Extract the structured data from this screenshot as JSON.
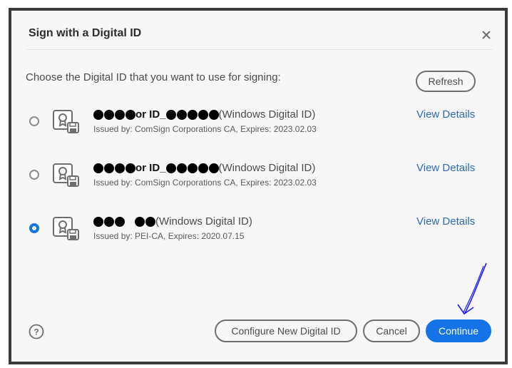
{
  "dialog": {
    "title": "Sign with a Digital ID",
    "close_icon": "close-icon"
  },
  "prompt": "Choose the Digital ID that you want to use for signing:",
  "refresh_label": "Refresh",
  "digital_ids": [
    {
      "selected": false,
      "name_visible_fragment": "or ID_",
      "type": "(Windows Digital ID)",
      "issued": "Issued by: ComSign Corporations CA, Expires: 2023.02.03",
      "view_details": "View Details",
      "icon": "certificate-icon"
    },
    {
      "selected": false,
      "name_visible_fragment": "or ID_",
      "type": "(Windows Digital ID)",
      "issued": "Issued by: ComSign Corporations CA, Expires: 2023.02.03",
      "view_details": "View Details",
      "icon": "certificate-icon"
    },
    {
      "selected": true,
      "name_visible_fragment": "",
      "type": "(Windows Digital ID)",
      "issued": "Issued by: PEI-CA, Expires: 2020.07.15",
      "view_details": "View Details",
      "icon": "certificate-icon"
    }
  ],
  "footer": {
    "help_icon": "help-icon",
    "configure_label": "Configure New Digital ID",
    "cancel_label": "Cancel",
    "continue_label": "Continue"
  },
  "colors": {
    "accent": "#1473e6",
    "link": "#2d6ab5",
    "annotation": "#1a1aff"
  }
}
